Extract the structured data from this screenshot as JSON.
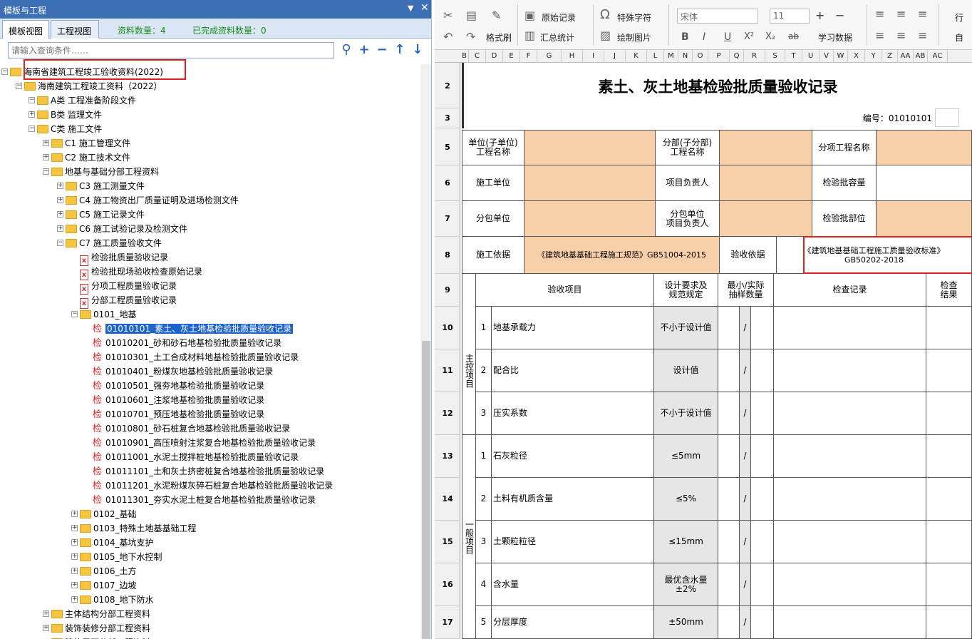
{
  "left_panel": {
    "title": "模板与工程",
    "pin_icon": "▼",
    "close_icon": "✕",
    "tabs": [
      "模板视图",
      "工程视图"
    ],
    "stats": {
      "count": "资料数量：4",
      "done": "已完成资料数量：0"
    },
    "search_placeholder": "请输入查询条件……",
    "tree": [
      {
        "label": "海南省建筑工程竣工验收资料(2022)",
        "type": "folder"
      },
      {
        "label": "海南建筑工程竣工资料（2022）",
        "type": "folder"
      },
      {
        "label": "A类 工程准备阶段文件",
        "type": "folder"
      },
      {
        "label": "B类 监理文件",
        "type": "folder"
      },
      {
        "label": "C类 施工文件",
        "type": "folder"
      },
      {
        "label": "C1 施工管理文件",
        "type": "folder"
      },
      {
        "label": "C2 施工技术文件",
        "type": "folder"
      },
      {
        "label": "地基与基础分部工程资料",
        "type": "folder"
      },
      {
        "label": "C3 施工测量文件",
        "type": "folder"
      },
      {
        "label": "C4 施工物资出厂质量证明及进场检测文件",
        "type": "folder"
      },
      {
        "label": "C5 施工记录文件",
        "type": "folder"
      },
      {
        "label": "C6 施工试验记录及检测文件",
        "type": "folder"
      },
      {
        "label": "C7 施工质量验收文件",
        "type": "folder"
      },
      {
        "label": "检验批质量验收记录",
        "type": "doc"
      },
      {
        "label": "检验批现场验收检查原始记录",
        "type": "doc"
      },
      {
        "label": "分项工程质量验收记录",
        "type": "doc"
      },
      {
        "label": "分部工程质量验收记录",
        "type": "doc"
      },
      {
        "label": "0101_地基",
        "type": "folder"
      },
      {
        "label": "01010101_素土、灰土地基检验批质量验收记录",
        "type": "jian",
        "selected": true
      },
      {
        "label": "01010201_砂和砂石地基检验批质量验收记录",
        "type": "jian"
      },
      {
        "label": "01010301_土工合成材料地基检验批质量验收记录",
        "type": "jian"
      },
      {
        "label": "01010401_粉煤灰地基检验批质量验收记录",
        "type": "jian"
      },
      {
        "label": "01010501_强夯地基检验批质量验收记录",
        "type": "jian"
      },
      {
        "label": "01010601_注浆地基检验批质量验收记录",
        "type": "jian"
      },
      {
        "label": "01010701_预压地基检验批质量验收记录",
        "type": "jian"
      },
      {
        "label": "01010801_砂石桩复合地基检验批质量验收记录",
        "type": "jian"
      },
      {
        "label": "01010901_高压喷射注浆复合地基检验批质量验收记录",
        "type": "jian"
      },
      {
        "label": "01011001_水泥土搅拌桩地基检验批质量验收记录",
        "type": "jian"
      },
      {
        "label": "01011101_土和灰土挤密桩复合地基检验批质量验收记录",
        "type": "jian"
      },
      {
        "label": "01011201_水泥粉煤灰碎石桩复合地基检验批质量验收记录",
        "type": "jian"
      },
      {
        "label": "01011301_夯实水泥土桩复合地基检验批质量验收记录",
        "type": "jian"
      },
      {
        "label": "0102_基础",
        "type": "folder"
      },
      {
        "label": "0103_特殊土地基基础工程",
        "type": "folder"
      },
      {
        "label": "0104_基坑支护",
        "type": "folder"
      },
      {
        "label": "0105_地下水控制",
        "type": "folder"
      },
      {
        "label": "0106_土方",
        "type": "folder"
      },
      {
        "label": "0107_边坡",
        "type": "folder"
      },
      {
        "label": "0108_地下防水",
        "type": "folder"
      },
      {
        "label": "主体结构分部工程资料",
        "type": "folder"
      },
      {
        "label": "装饰装修分部工程资料",
        "type": "folder"
      },
      {
        "label": "建筑屋面分部工程资料",
        "type": "folder"
      }
    ],
    "jian_char": "检"
  },
  "ribbon": {
    "original_record": "原始记录",
    "special_char": "特殊字符",
    "font": "宋体",
    "font_size": "11",
    "format_brush": "格式刷",
    "summary": "汇总统计",
    "draw_pic": "绘制图片",
    "learn_data": "学习数据",
    "row_label": "行",
    "self_label": "自",
    "bold": "B",
    "italic": "I",
    "underline": "U",
    "sup": "X²",
    "sub": "X₂",
    "strike": "ab"
  },
  "columns": [
    "B",
    "C",
    "D",
    "E",
    "F",
    "G",
    "H",
    "I",
    "J",
    "K",
    "L",
    "M",
    "N",
    "O",
    "P",
    "Q",
    "R",
    "S",
    "T",
    "U",
    "V",
    "W",
    "X",
    "Y",
    "Z",
    "AA",
    "AB",
    "AC"
  ],
  "rows": [
    "2",
    "3",
    "5",
    "6",
    "7",
    "8",
    "9",
    "10",
    "11",
    "12",
    "13",
    "14",
    "15",
    "16",
    "17"
  ],
  "form": {
    "title": "素土、灰土地基检验批质量验收记录",
    "number": "编号：01010101",
    "r5": {
      "a": "单位(子单位)\n工程名称",
      "b": "分部(子分部)\n工程名称",
      "c": "分项工程名称"
    },
    "r6": {
      "a": "施工单位",
      "b": "项目负责人",
      "c": "检验批容量"
    },
    "r7": {
      "a": "分包单位",
      "b": "分包单位\n项目负责人",
      "c": "检验批部位"
    },
    "r8": {
      "a": "施工依据",
      "b": "《建筑地基基础工程施工规范》GB51004-2015",
      "c": "验收依据",
      "d": "《建筑地基基础工程施工质量验收标准》\nGB50202-2018"
    },
    "r9": {
      "a": "验收项目",
      "b": "设计要求及\n规范规定",
      "c": "最小/实际\n抽样数量",
      "d": "检查记录",
      "e": "检查\n结果"
    },
    "main_label": "主控项目",
    "general_label": "一般项目",
    "items": [
      {
        "n": "1",
        "name": "地基承载力",
        "req": "不小于设计值",
        "s": "/"
      },
      {
        "n": "2",
        "name": "配合比",
        "req": "设计值",
        "s": "/"
      },
      {
        "n": "3",
        "name": "压实系数",
        "req": "不小于设计值",
        "s": "/"
      },
      {
        "n": "1",
        "name": "石灰粒径",
        "req": "≤5mm",
        "s": "/"
      },
      {
        "n": "2",
        "name": "土料有机质含量",
        "req": "≤5%",
        "s": "/"
      },
      {
        "n": "3",
        "name": "土颗粒粒径",
        "req": "≤15mm",
        "s": "/"
      },
      {
        "n": "4",
        "name": "含水量",
        "req": "最优含水量\n±2%",
        "s": "/"
      },
      {
        "n": "5",
        "name": "分层厚度",
        "req": "±50mm",
        "s": "/"
      }
    ]
  }
}
